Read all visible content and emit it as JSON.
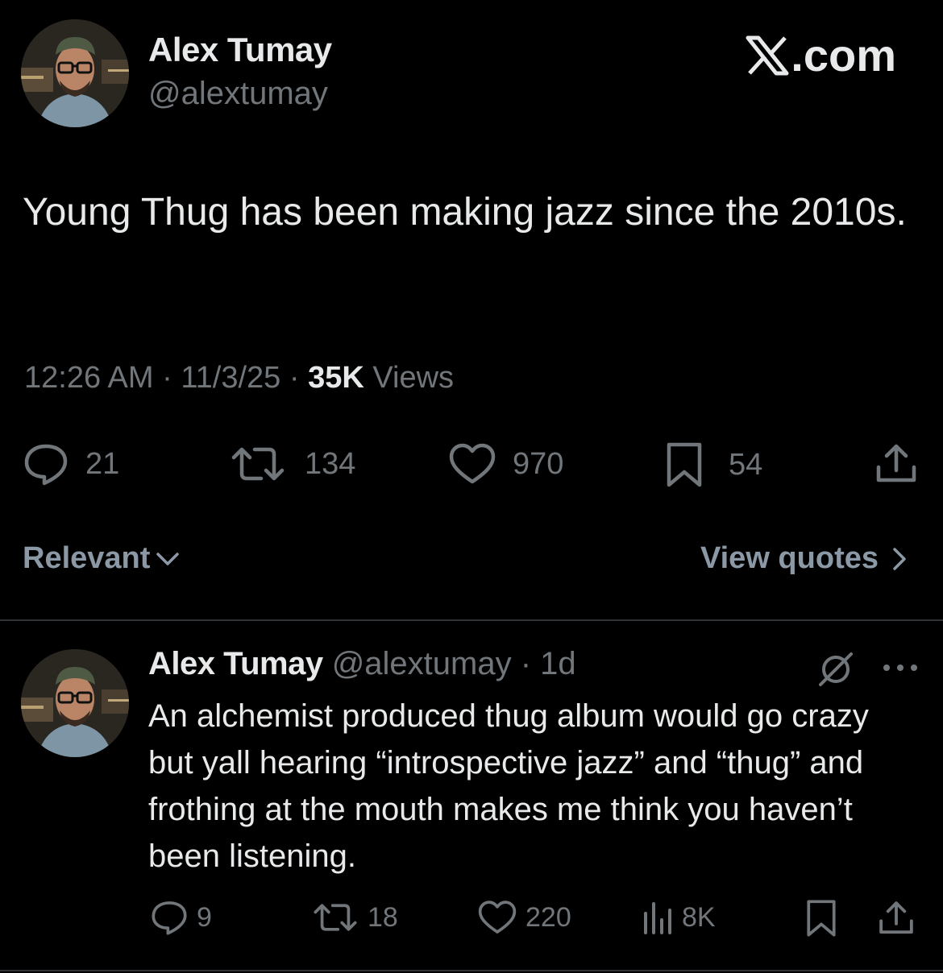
{
  "tweet": {
    "author_name": "Alex Tumay",
    "author_handle": "@alextumay",
    "text": "Young Thug has been making jazz since the 2010s.",
    "time": "12:26 AM",
    "sep1": " · ",
    "date": "11/3/25",
    "sep2": " · ",
    "views_count": "35K",
    "views_label": " Views",
    "stats": {
      "replies": "21",
      "reposts": "134",
      "likes": "970",
      "bookmarks": "54"
    }
  },
  "site_label": ".com",
  "sort": {
    "relevant_label": "Relevant",
    "view_quotes_label": "View quotes"
  },
  "reply": {
    "author_name": "Alex Tumay",
    "author_handle": "@alextumay",
    "separator": " · ",
    "time": "1d",
    "text": "An alchemist produced thug album would go crazy but yall hearing “introspective jazz” and “thug” and frothing at the mouth makes me think you haven’t been listening.",
    "stats": {
      "replies": "9",
      "reposts": "18",
      "likes": "220",
      "views": "8K"
    }
  },
  "icons": {
    "reply": "speech-bubble-icon",
    "repost": "repost-arrows-icon",
    "like": "heart-icon",
    "bookmark": "bookmark-icon",
    "share": "share-upload-icon",
    "views": "bar-chart-icon",
    "grok": "grok-icon",
    "more": "more-dots-icon",
    "x_logo": "x-logo-icon"
  },
  "colors": {
    "background": "#000000",
    "primary_text": "#e7e9ea",
    "secondary_text": "#71767b",
    "divider": "#2f3336"
  }
}
